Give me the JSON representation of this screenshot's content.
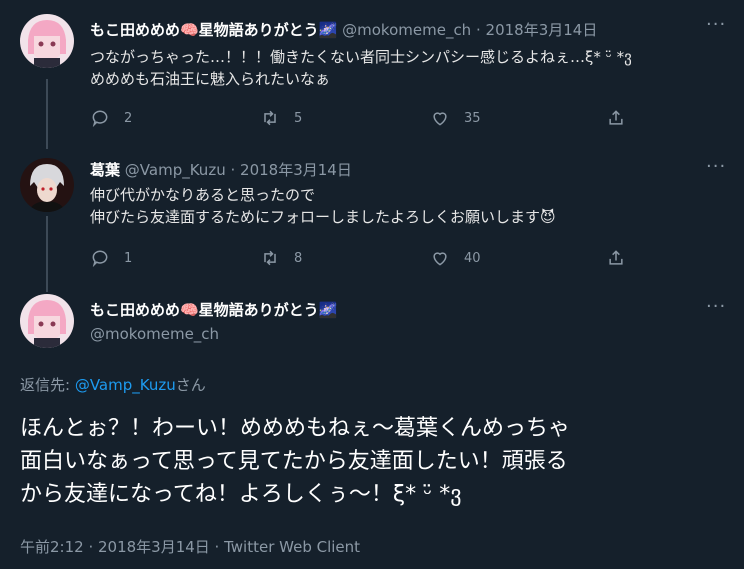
{
  "tweet1": {
    "name": "もこ田めめめ🧠星物語ありがとう🌌",
    "handle": "@mokomeme_ch",
    "separator": "·",
    "date": "2018年3月14日",
    "text_line1": "つながっちゃった…！！！働きたくない者同士シンパシー感じるよねぇ…ξ* ᵕ̈ *ვ",
    "text_line2": "めめめも石油王に魅入られたいなぁ",
    "replies": "2",
    "retweets": "5",
    "likes": "35"
  },
  "tweet2": {
    "name": "葛葉",
    "handle": "@Vamp_Kuzu",
    "separator": "·",
    "date": "2018年3月14日",
    "text_line1": "伸び代がかなりあると思ったので",
    "text_line2": "伸びたら友達面するためにフォローしましたよろしくお願いします😈",
    "replies": "1",
    "retweets": "8",
    "likes": "40"
  },
  "main_tweet": {
    "name": "もこ田めめめ🧠星物語ありがとう🌌",
    "handle": "@mokomeme_ch",
    "reply_prefix": "返信先: ",
    "reply_link": "@Vamp_Kuzu",
    "reply_suffix": "さん",
    "text_line1": "ほんとぉ？！わーい！めめめもねぇ〜葛葉くんめっちゃ",
    "text_line2": "面白いなぁって思って見てたから友達面したい！頑張る",
    "text_line3": "から友達になってね！よろしくぅ〜！ξ* ᵕ̈ *ვ",
    "meta": "午前2:12 · 2018年3月14日 · Twitter Web Client"
  },
  "more_label": "···",
  "colors": {
    "background": "#15202b",
    "link": "#1d9bf0",
    "muted": "#8b98a5"
  },
  "icons": [
    "reply-icon",
    "retweet-icon",
    "like-icon",
    "share-icon",
    "more-icon"
  ]
}
